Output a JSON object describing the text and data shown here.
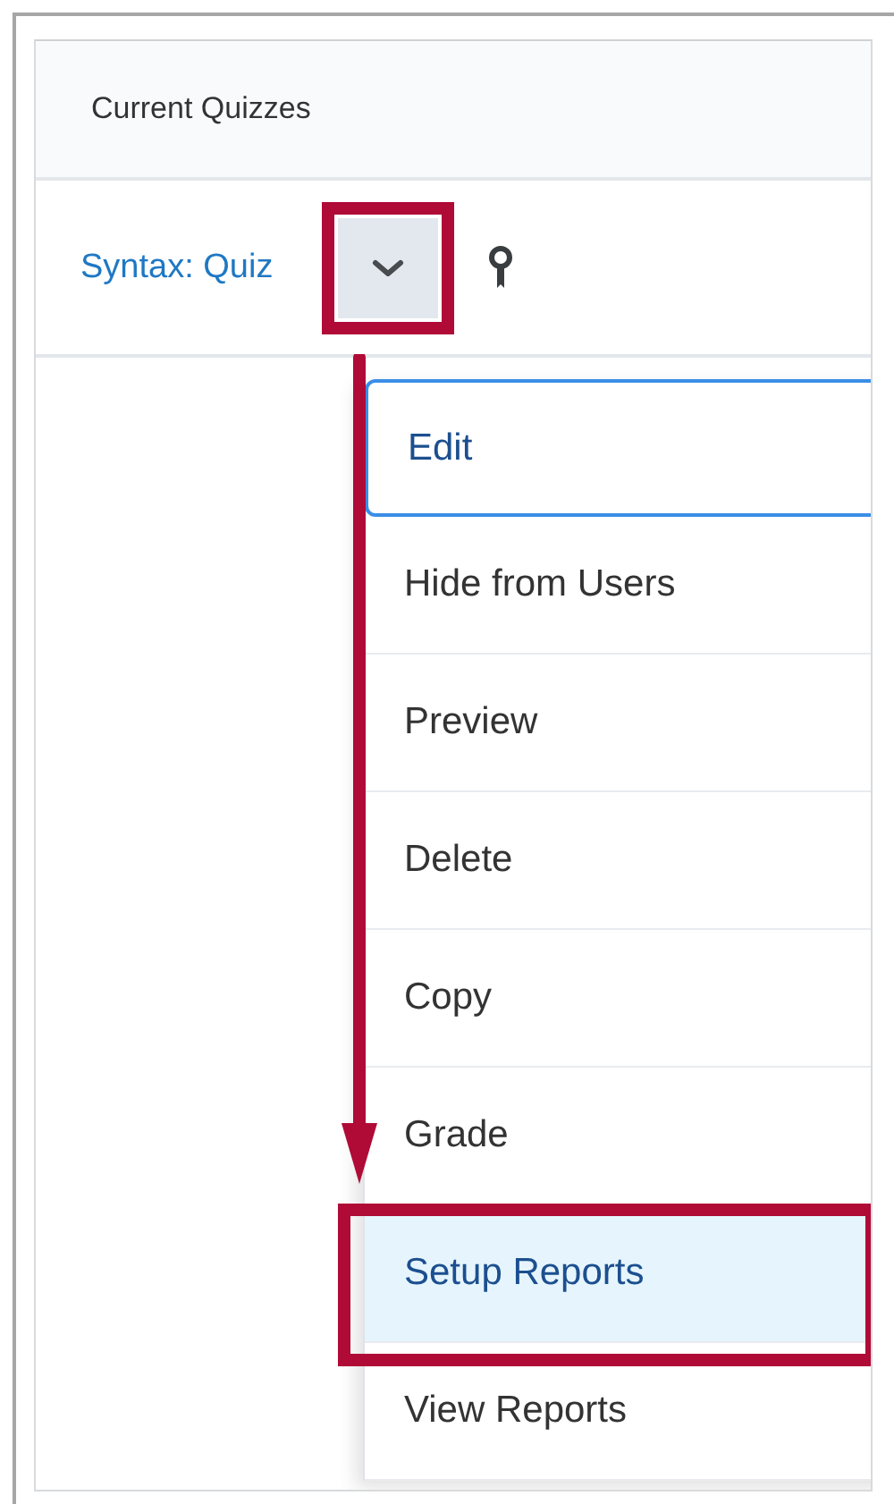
{
  "table": {
    "header": "Current Quizzes",
    "row": {
      "link": "Syntax: Quiz"
    }
  },
  "menu": {
    "items": [
      {
        "label": "Edit",
        "focused": true,
        "selected": false
      },
      {
        "label": "Hide from Users",
        "focused": false,
        "selected": false
      },
      {
        "label": "Preview",
        "focused": false,
        "selected": false
      },
      {
        "label": "Delete",
        "focused": false,
        "selected": false
      },
      {
        "label": "Copy",
        "focused": false,
        "selected": false
      },
      {
        "label": "Grade",
        "focused": false,
        "selected": false
      },
      {
        "label": "Setup Reports",
        "focused": false,
        "selected": true
      },
      {
        "label": "View Reports",
        "focused": false,
        "selected": false
      }
    ]
  }
}
